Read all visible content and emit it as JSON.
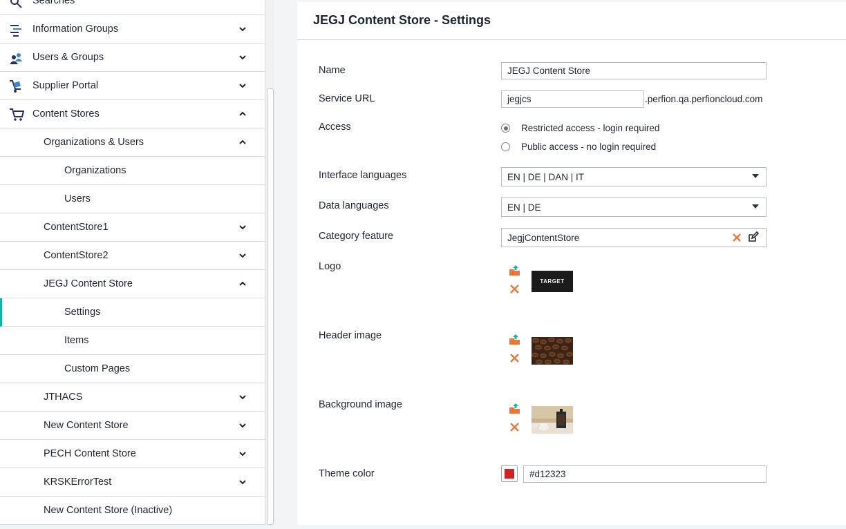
{
  "sidebar": {
    "searches_label": "Searches",
    "items": [
      {
        "label": "Information Groups",
        "icon": "list-icon",
        "level": 0,
        "expanded": false
      },
      {
        "label": "Users & Groups",
        "icon": "users-icon",
        "level": 0,
        "expanded": false
      },
      {
        "label": "Supplier Portal",
        "icon": "supplier-icon",
        "level": 0,
        "expanded": false
      },
      {
        "label": "Content Stores",
        "icon": "cart-icon",
        "level": 0,
        "expanded": true
      },
      {
        "label": "Organizations & Users",
        "level": 1,
        "expanded": true
      },
      {
        "label": "Organizations",
        "level": 2
      },
      {
        "label": "Users",
        "level": 2
      },
      {
        "label": "ContentStore1",
        "level": 1,
        "expanded": false
      },
      {
        "label": "ContentStore2",
        "level": 1,
        "expanded": false
      },
      {
        "label": "JEGJ Content Store",
        "level": 1,
        "expanded": true
      },
      {
        "label": "Settings",
        "level": 2,
        "active": true
      },
      {
        "label": "Items",
        "level": 2
      },
      {
        "label": "Custom Pages",
        "level": 2
      },
      {
        "label": "JTHACS",
        "level": 1,
        "expanded": false
      },
      {
        "label": "New Content Store",
        "level": 1,
        "expanded": false
      },
      {
        "label": "PECH Content Store",
        "level": 1,
        "expanded": false
      },
      {
        "label": "KRSKErrorTest",
        "level": 1,
        "expanded": false
      },
      {
        "label": "New Content Store (Inactive)",
        "level": 1
      }
    ],
    "active_color": "#13b6a4"
  },
  "main": {
    "title": "JEGJ Content Store - Settings",
    "fields": {
      "name": {
        "label": "Name",
        "value": "JEGJ Content Store"
      },
      "service_url": {
        "label": "Service URL",
        "value": "jegjcs",
        "suffix": ".perfion.qa.perfioncloud.com"
      },
      "access": {
        "label": "Access",
        "options": [
          {
            "label": "Restricted access - login required",
            "checked": true
          },
          {
            "label": "Public access - no login required",
            "checked": false
          }
        ]
      },
      "interface_languages": {
        "label": "Interface languages",
        "value": "EN | DE | DAN | IT"
      },
      "data_languages": {
        "label": "Data languages",
        "value": "EN | DE"
      },
      "category_feature": {
        "label": "Category feature",
        "value": "JegjContentStore"
      },
      "logo": {
        "label": "Logo",
        "image_text": "TARGET"
      },
      "header_image": {
        "label": "Header image"
      },
      "background_image": {
        "label": "Background image"
      },
      "theme_color": {
        "label": "Theme color",
        "value": "#d12323"
      }
    },
    "accent_orange": "#e8793a"
  }
}
